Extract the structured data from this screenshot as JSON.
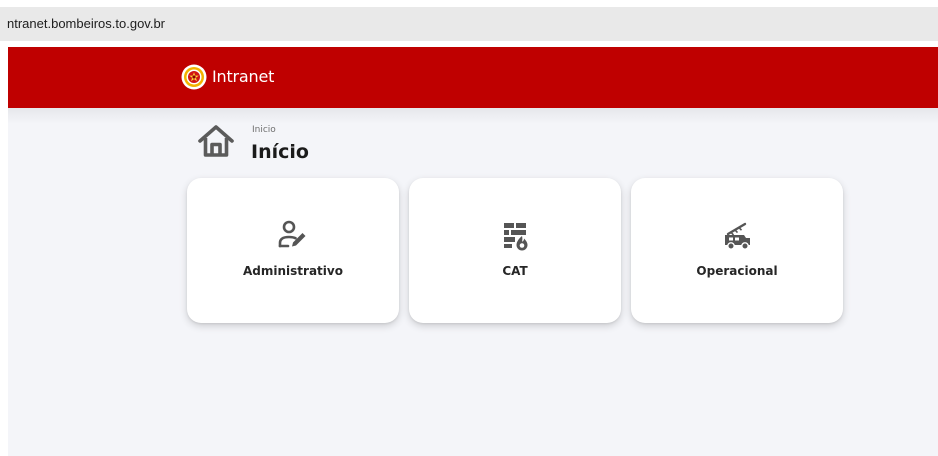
{
  "browser": {
    "url": "ntranet.bombeiros.to.gov.br"
  },
  "header": {
    "brand": "Intranet",
    "logo_icon": "fire-department-emblem-icon"
  },
  "breadcrumb": {
    "label": "Inicio",
    "icon": "home-icon"
  },
  "page": {
    "title": "Início"
  },
  "cards": [
    {
      "label": "Administrativo",
      "icon": "user-edit-icon"
    },
    {
      "label": "CAT",
      "icon": "brick-wall-fire-icon"
    },
    {
      "label": "Operacional",
      "icon": "fire-truck-icon"
    }
  ],
  "colors": {
    "brand": "#bf0000",
    "background": "#f4f5f9",
    "icon": "#555555"
  }
}
